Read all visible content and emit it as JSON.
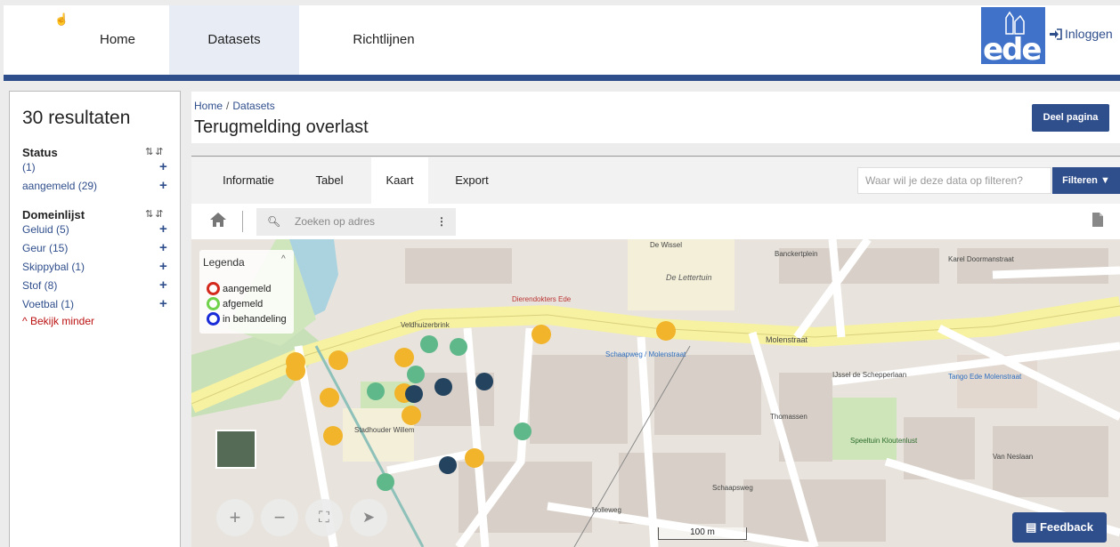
{
  "nav": {
    "items": [
      {
        "label": "Home"
      },
      {
        "label": "Datasets"
      },
      {
        "label": "Richtlijnen"
      }
    ],
    "login": "Inloggen",
    "logo_text": "ede"
  },
  "sidebar": {
    "results": "30 resultaten",
    "status_title": "Status",
    "status_items": [
      {
        "label": "(1)"
      },
      {
        "label": "aangemeld (29)"
      }
    ],
    "domain_title": "Domeinlijst",
    "domain_items": [
      {
        "label": "Geluid (5)"
      },
      {
        "label": "Geur (15)"
      },
      {
        "label": "Skippybal (1)"
      },
      {
        "label": "Stof (8)"
      },
      {
        "label": "Voetbal (1)"
      }
    ],
    "show_less": "Bekijk minder"
  },
  "header": {
    "breadcrumb": [
      "Home",
      "Datasets"
    ],
    "title": "Terugmelding overlast",
    "share": "Deel pagina"
  },
  "tabs": [
    {
      "label": "Informatie"
    },
    {
      "label": "Tabel"
    },
    {
      "label": "Kaart"
    },
    {
      "label": "Export"
    }
  ],
  "filter": {
    "placeholder": "Waar wil je deze data op filteren?",
    "button": "Filteren"
  },
  "maptoolbar": {
    "search_placeholder": "Zoeken op adres"
  },
  "legend": {
    "title": "Legenda",
    "items": [
      {
        "label": "aangemeld",
        "color": "#d42a1e"
      },
      {
        "label": "afgemeld",
        "color": "#6fd24a"
      },
      {
        "label": "in behandeling",
        "color": "#1a2bd8"
      }
    ]
  },
  "map_labels": {
    "molenstraat": "Molenstraat",
    "banckertplein": "Banckertplein",
    "de_letteruin": "De Lettertuin",
    "karel": "Karel Doormanstraat",
    "ijssel": "IJssel de Schepperlaan",
    "holleweg": "Holleweg",
    "schaapsweg": "Schaapsweg",
    "tango": "Tango Ede Molenstraat",
    "speeltuin": "Speeltuin Kloutenlust",
    "dierenartsen": "Dierendokters Ede",
    "stadhouder": "Stadhouder Willem",
    "schaapweg_stop": "Schaapweg / Molenstraat",
    "veldhuizerbrink": "Veldhuizerbrink",
    "thomassen": "Thomassen",
    "de_wissel": "De Wissel",
    "neslaan": "Van Neslaan"
  },
  "scale": "100 m",
  "feedback": "Feedback",
  "colors": {
    "brand": "#2f4e8c",
    "geur_marker": "#f1b42b",
    "stof_marker": "#5fb88a",
    "geluid_marker": "#24435f"
  }
}
